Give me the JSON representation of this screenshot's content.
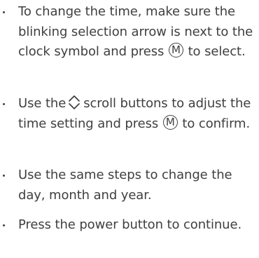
{
  "steps": [
    {
      "a": "To change the time, make sure the blinking selection arrow is next to the clock symbol and press",
      "b": "to select."
    },
    {
      "a": "Use the",
      "b": "scroll buttons to adjust the time setting and press",
      "c": "to confirm."
    },
    {
      "a": "Use the same steps to change the day, month and year."
    },
    {
      "a": "Press the power button to continue."
    }
  ],
  "icons": {
    "menu_button_letter": "M",
    "menu_button": "m-button-icon",
    "scroll_buttons": "up-down-chevron-icon"
  }
}
